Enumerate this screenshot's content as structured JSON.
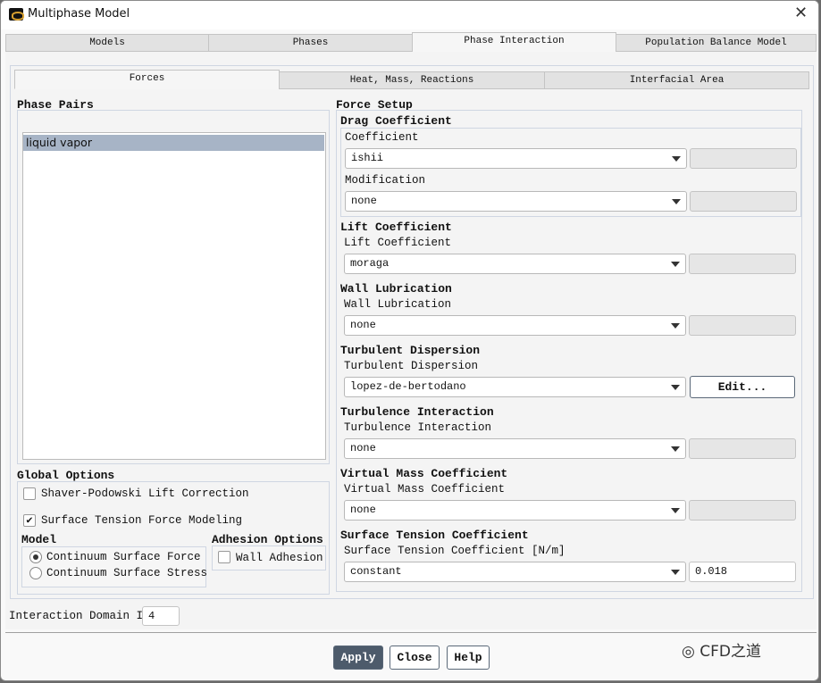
{
  "window": {
    "title": "Multiphase Model"
  },
  "tabs": [
    "Models",
    "Phases",
    "Phase Interaction",
    "Population Balance Model"
  ],
  "subtabs": [
    "Forces",
    "Heat, Mass, Reactions",
    "Interfacial Area"
  ],
  "phase_pairs": {
    "label": "Phase Pairs",
    "items": [
      "liquid vapor"
    ]
  },
  "global_options": {
    "label": "Global Options",
    "shaver": "Shaver-Podowski Lift Correction",
    "shaver_checked": false,
    "surface_tension": "Surface Tension Force Modeling",
    "surface_tension_checked": true,
    "model_label": "Model",
    "model_options": [
      "Continuum Surface Force",
      "Continuum Surface Stress"
    ],
    "adhesion_label": "Adhesion Options",
    "wall_adhesion": "Wall Adhesion"
  },
  "force_setup": {
    "label": "Force Setup",
    "drag": {
      "heading": "Drag Coefficient",
      "coef_label": "Coefficient",
      "coef_value": "ishii",
      "mod_label": "Modification",
      "mod_value": "none"
    },
    "lift": {
      "heading": "Lift Coefficient",
      "label": "Lift Coefficient",
      "value": "moraga"
    },
    "wall": {
      "heading": "Wall Lubrication",
      "label": "Wall Lubrication",
      "value": "none"
    },
    "turb_disp": {
      "heading": "Turbulent Dispersion",
      "label": "Turbulent Dispersion",
      "value": "lopez-de-bertodano",
      "edit": "Edit..."
    },
    "turb_int": {
      "heading": "Turbulence Interaction",
      "label": "Turbulence Interaction",
      "value": "none"
    },
    "virtual": {
      "heading": "Virtual Mass Coefficient",
      "label": "Virtual Mass Coefficient",
      "value": "none"
    },
    "surface": {
      "heading": "Surface Tension Coefficient",
      "label": "Surface Tension Coefficient [N/m]",
      "value": "constant",
      "number": "0.018"
    }
  },
  "domain": {
    "label": "Interaction Domain ID",
    "value": "4"
  },
  "buttons": {
    "apply": "Apply",
    "close": "Close",
    "help": "Help"
  },
  "watermark": "CFD之道"
}
